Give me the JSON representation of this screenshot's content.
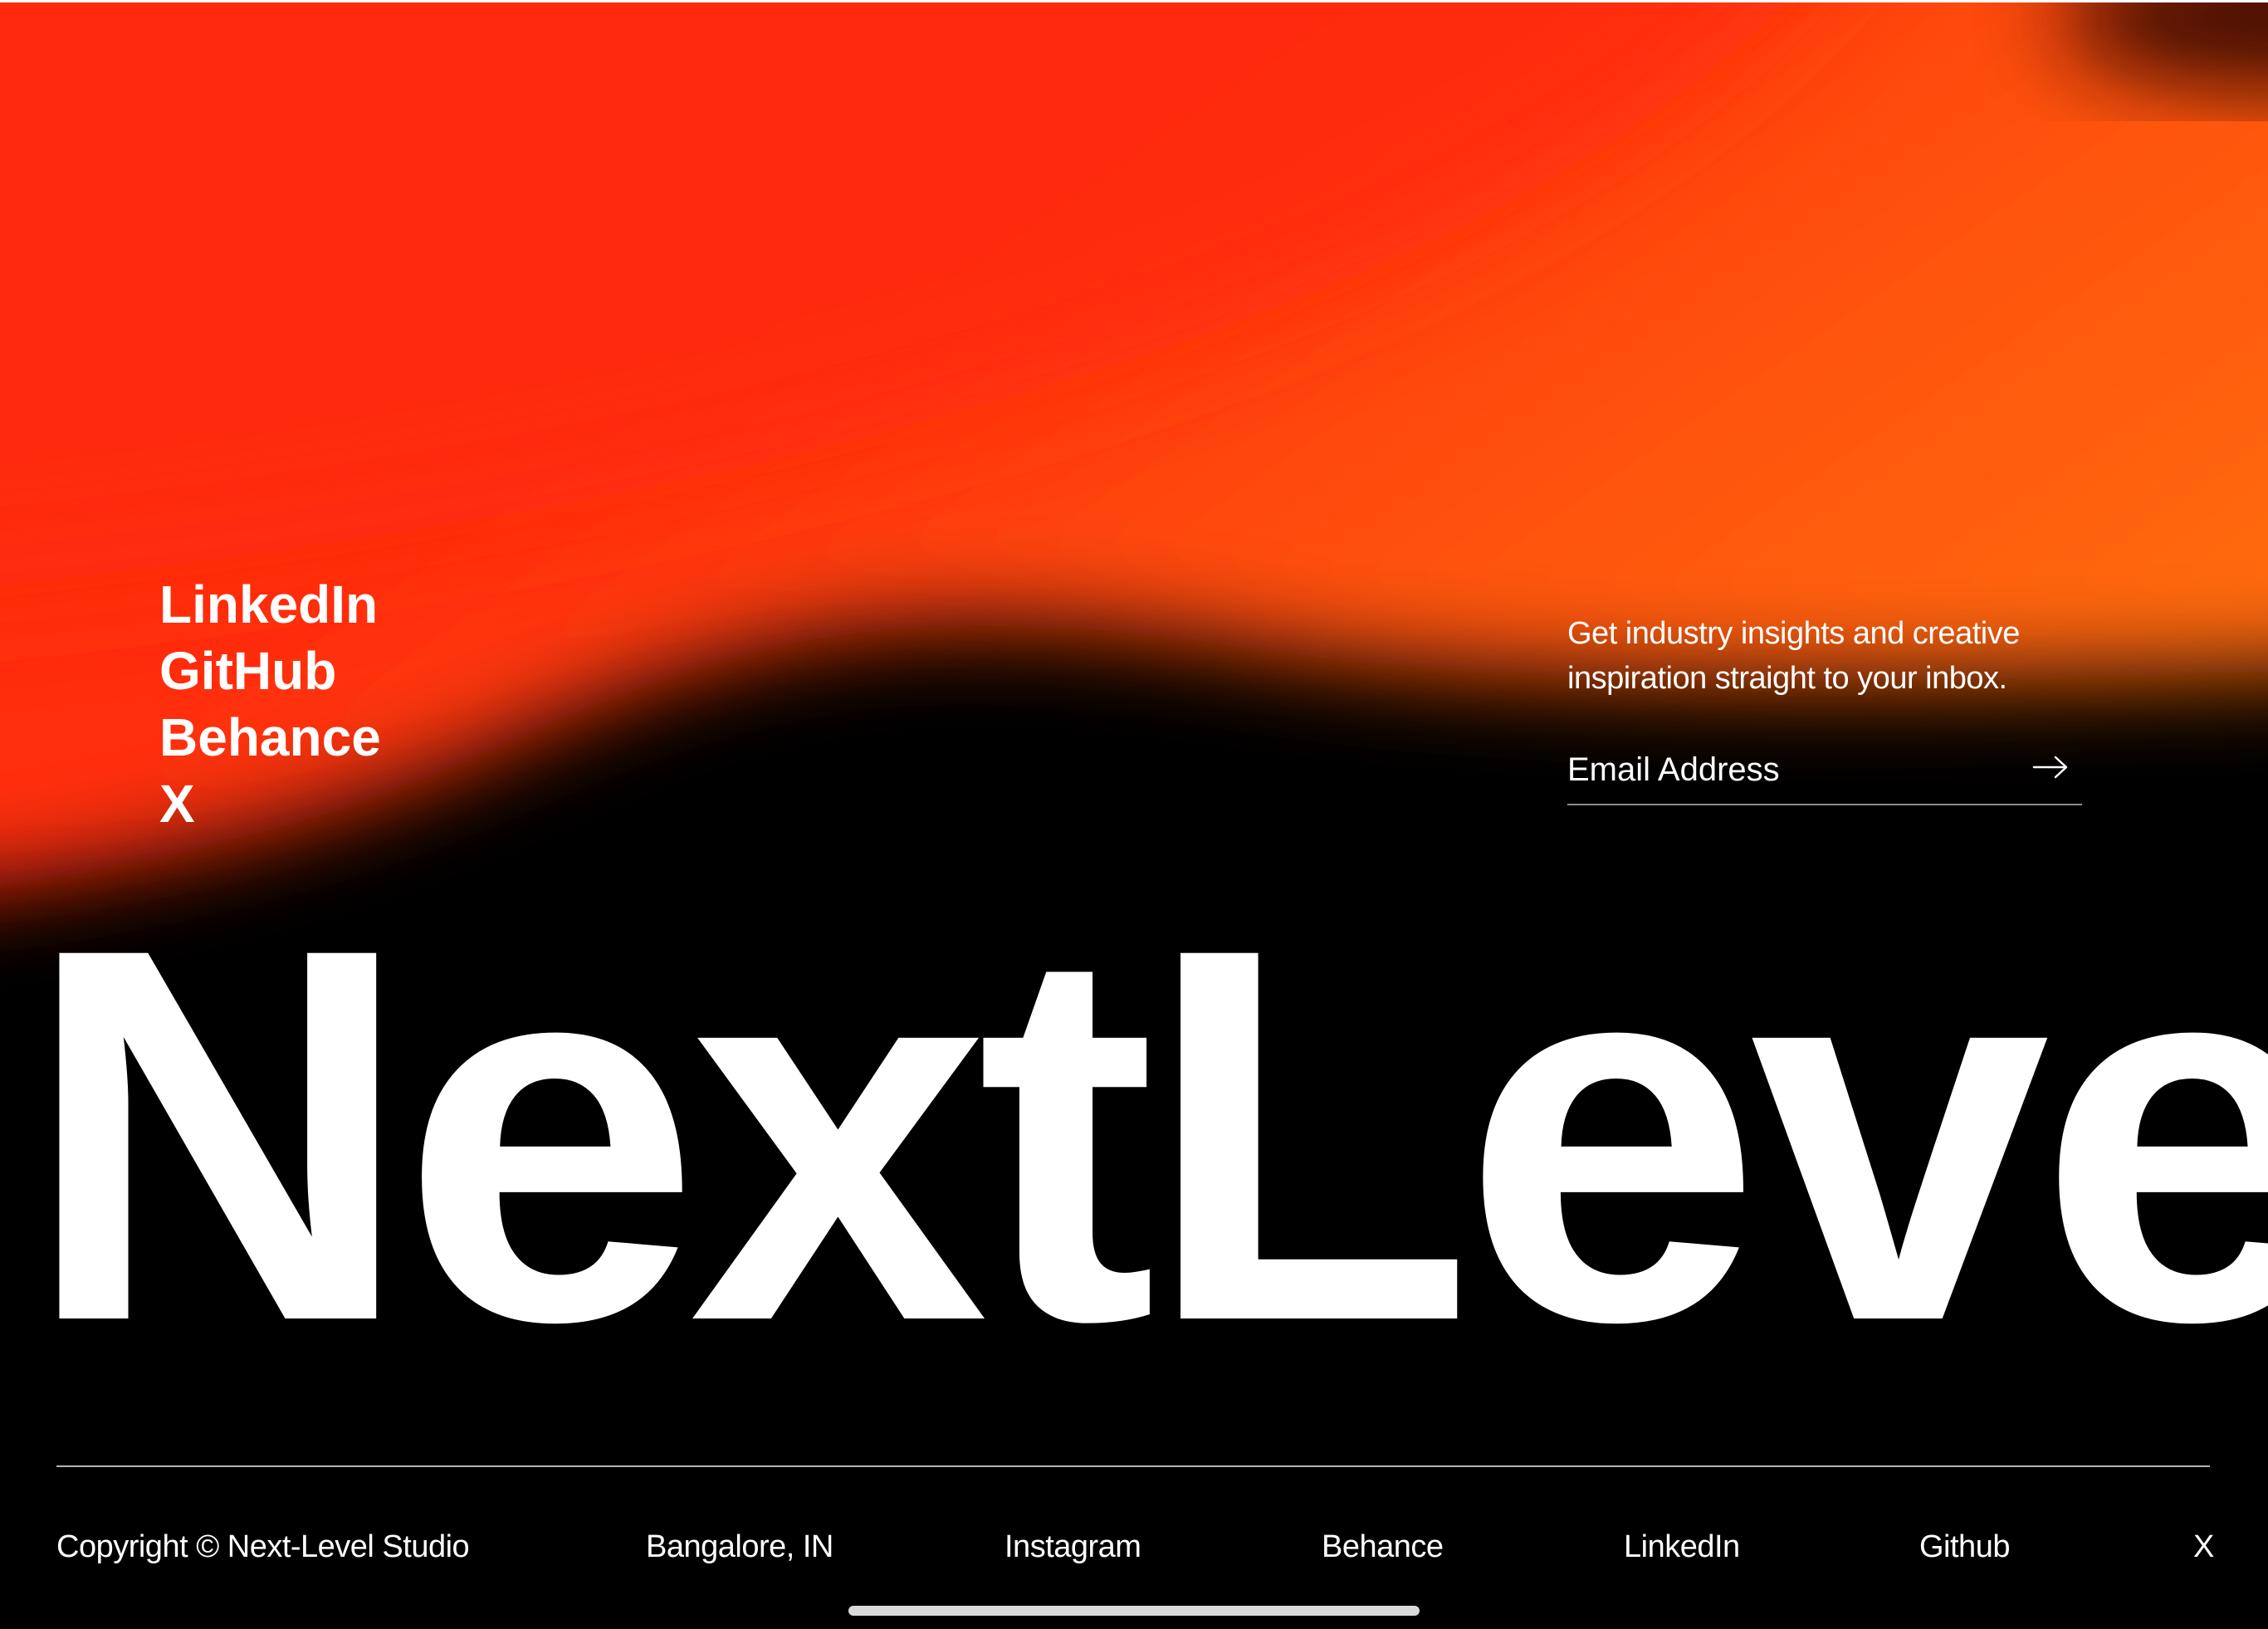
{
  "theme": {
    "background": "#000000",
    "gradient_red": "#FF2A0E",
    "gradient_orange": "#FF5C0C",
    "text": "#FFFFFF"
  },
  "social": {
    "items": [
      {
        "label": "LinkedIn"
      },
      {
        "label": "GitHub"
      },
      {
        "label": "Behance"
      },
      {
        "label": "X"
      }
    ]
  },
  "newsletter": {
    "line1": "Get industry insights and creative",
    "line2": "inspiration straight to your inbox.",
    "email_placeholder": "Email Address",
    "submit_icon": "arrow-right-icon"
  },
  "brand": {
    "wordmark": "NextLevel"
  },
  "footer": {
    "copyright": "Copyright © Next-Level Studio",
    "location": "Bangalore, IN",
    "links": [
      {
        "label": "Instagram"
      },
      {
        "label": "Behance"
      },
      {
        "label": "LinkedIn"
      },
      {
        "label": "Github"
      },
      {
        "label": "X"
      }
    ]
  }
}
